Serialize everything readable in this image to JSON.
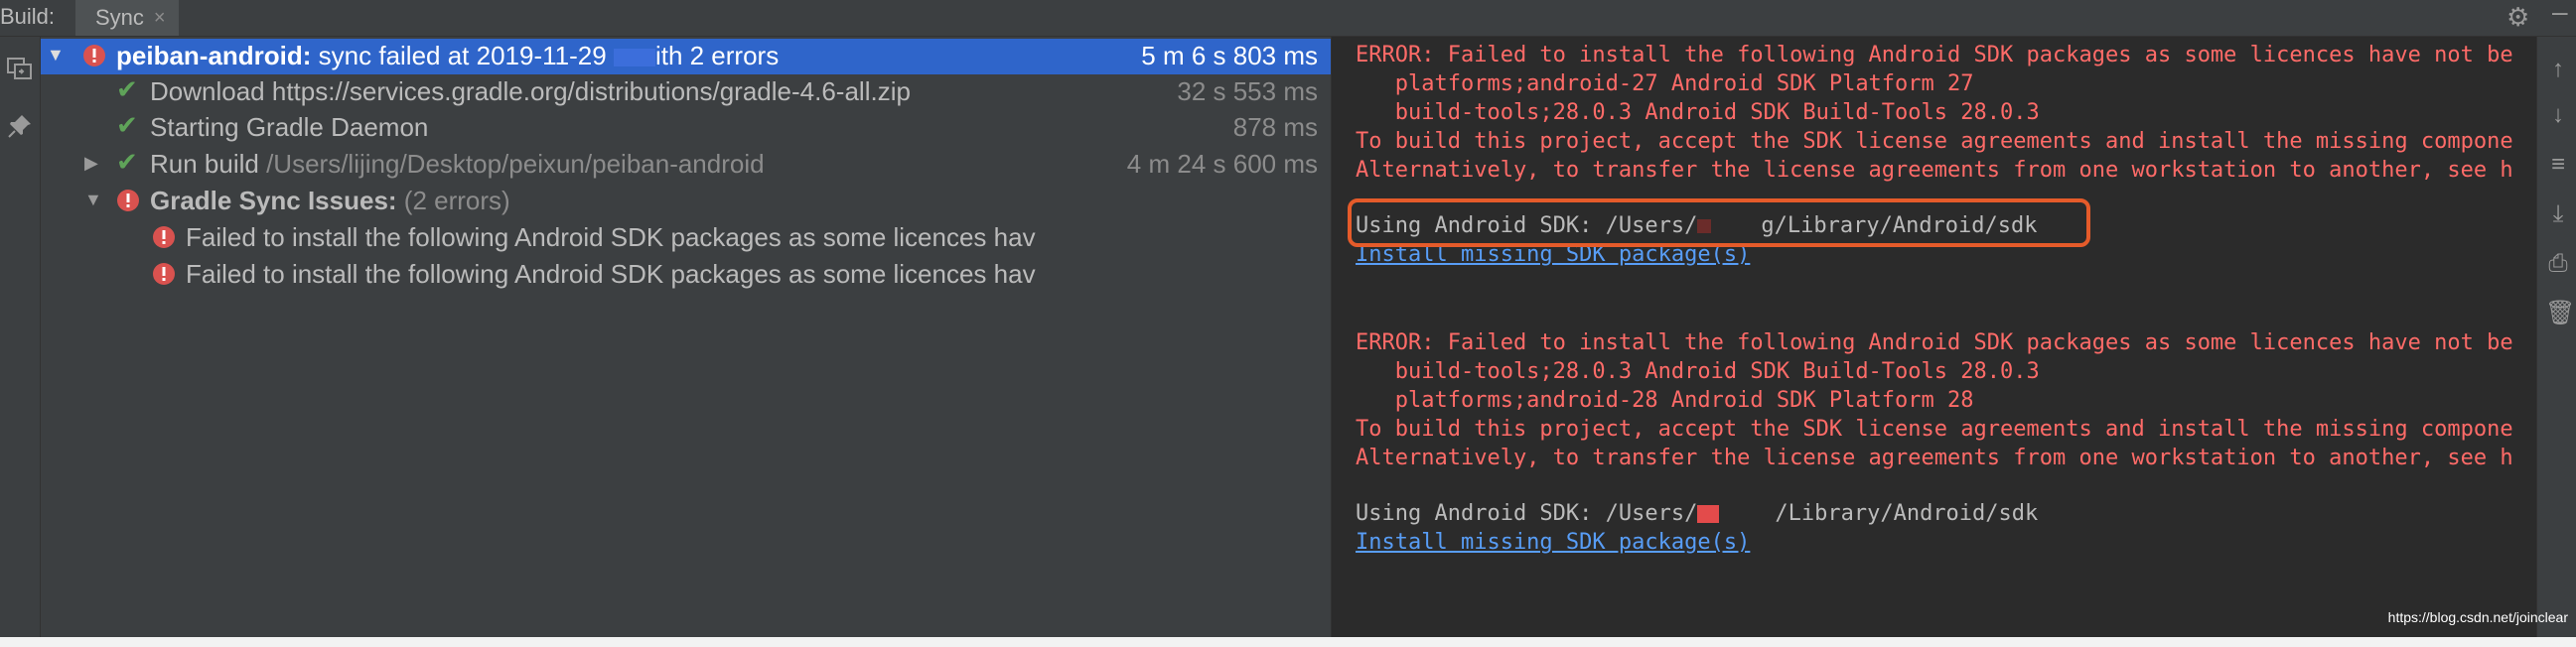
{
  "header": {
    "build_label": "Build:",
    "tab_label": "Sync",
    "tab_close": "×",
    "gear_icon": "gear-icon",
    "minimize_icon": "minimize-icon"
  },
  "left_toolbar": {
    "icons": [
      "restore-layout-icon",
      "pin-icon"
    ]
  },
  "tree": {
    "rows": [
      {
        "id": "root",
        "arrow": "▼",
        "status": "error",
        "name": "peiban-android:",
        "text_before": " sync failed at 2019-11-29",
        "text_after": "ith 2 errors",
        "time": "5 m 6 s 803 ms"
      },
      {
        "id": "download",
        "status": "success",
        "text": "Download https://services.gradle.org/distributions/gradle-4.6-all.zip",
        "time": "32 s 553 ms"
      },
      {
        "id": "daemon",
        "status": "success",
        "text": "Starting Gradle Daemon",
        "time": "878 ms"
      },
      {
        "id": "run-build",
        "arrow": "▶",
        "status": "success",
        "text": "Run build",
        "path": " /Users/lijing/Desktop/peixun/peiban-android",
        "time": "4 m 24 s 600 ms"
      },
      {
        "id": "sync-issues",
        "arrow": "▼",
        "status": "error",
        "name": "Gradle Sync Issues:",
        "count": " (2 errors)"
      },
      {
        "id": "issue-1",
        "status": "error",
        "text": "Failed to install the following Android SDK packages as some licences hav"
      },
      {
        "id": "issue-2",
        "status": "error",
        "text": "Failed to install the following Android SDK packages as some licences hav"
      }
    ]
  },
  "console": {
    "block1": {
      "error": "ERROR: Failed to install the following Android SDK packages as some licences have not be",
      "pkg1": "   platforms;android-27 Android SDK Platform 27",
      "pkg2": "   build-tools;28.0.3 Android SDK Build-Tools 28.0.3",
      "hint1": "To build this project, accept the SDK license agreements and install the missing compone",
      "hint2": "Alternatively, to transfer the license agreements from one workstation to another, see h",
      "sdk_prefix": "Using Android SDK: /Users/",
      "sdk_suffix": "g/Library/Android/sdk",
      "link": "Install missing SDK package(s)"
    },
    "block2": {
      "error": "ERROR: Failed to install the following Android SDK packages as some licences have not be",
      "pkg1": "   build-tools;28.0.3 Android SDK Build-Tools 28.0.3",
      "pkg2": "   platforms;android-28 Android SDK Platform 28",
      "hint1": "To build this project, accept the SDK license agreements and install the missing compone",
      "hint2": "Alternatively, to transfer the license agreements from one workstation to another, see h",
      "sdk_prefix": "Using Android SDK: /Users/",
      "sdk_suffix": "/Library/Android/sdk",
      "link": "Install missing SDK package(s)"
    }
  },
  "right_toolbar": {
    "icons": [
      "up-arrow-icon",
      "down-arrow-icon",
      "soft-wrap-icon",
      "scroll-to-end-icon",
      "print-icon",
      "trash-icon"
    ]
  },
  "watermark": "https://blog.csdn.net/joinclear",
  "colors": {
    "selected_row": "#2f65ca",
    "error_text": "#ff6b68",
    "link_text": "#589df6",
    "highlight_box": "#e55b2a",
    "success_check": "#5fa359",
    "error_icon": "#d9524f"
  }
}
